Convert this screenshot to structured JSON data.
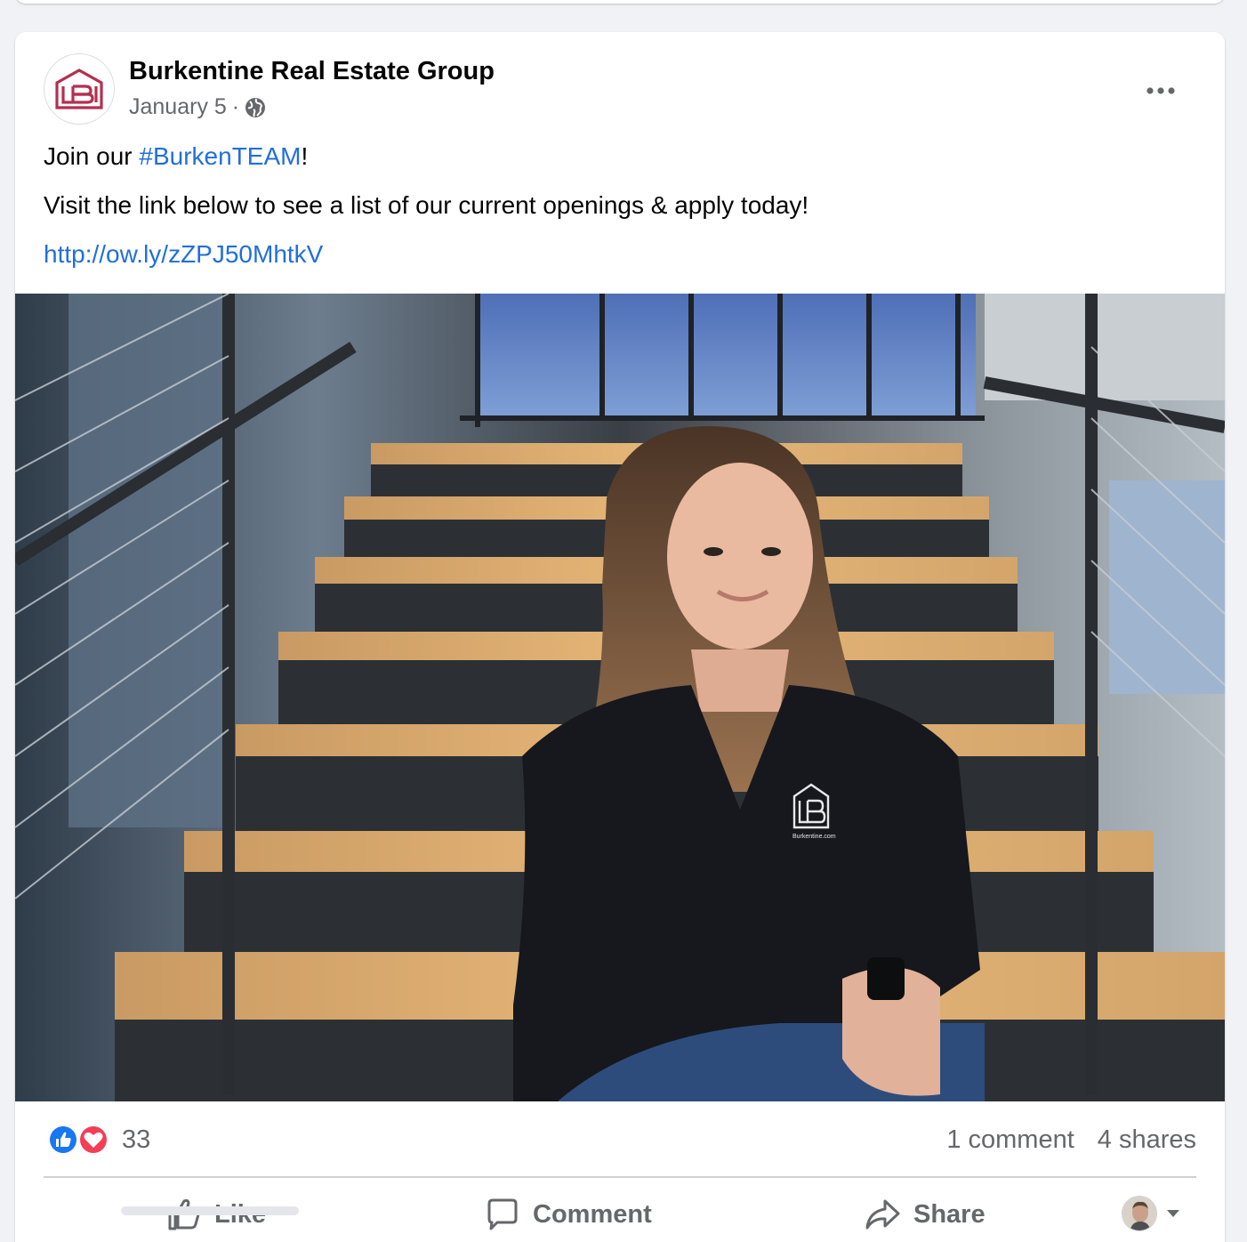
{
  "post": {
    "page_name": "Burkentine Real Estate Group",
    "date": "January 5",
    "separator": "·",
    "privacy_icon": "globe-icon",
    "more_icon": "more-options-icon",
    "text": {
      "line1_prefix": "Join our ",
      "hashtag": "#BurkenTEAM",
      "line1_suffix": "!",
      "line2": "Visit the link below to see a list of our current openings & apply today!",
      "link": "http://ow.ly/zZPJ50MhtkV"
    },
    "photo": {
      "shirt_logo_text": "Burkentine.com"
    }
  },
  "stats": {
    "reactions": [
      "like-reaction-icon",
      "love-reaction-icon"
    ],
    "reaction_count": "33",
    "comments": "1 comment",
    "shares": "4 shares"
  },
  "actions": {
    "like": "Like",
    "comment": "Comment",
    "share": "Share",
    "audience_icon": "chevron-down-icon"
  },
  "colors": {
    "brand": "#b52f4f",
    "link": "#216fdb",
    "like_blue": "#1877f2",
    "love_red": "#f33e58",
    "secondary_text": "#65676b"
  }
}
